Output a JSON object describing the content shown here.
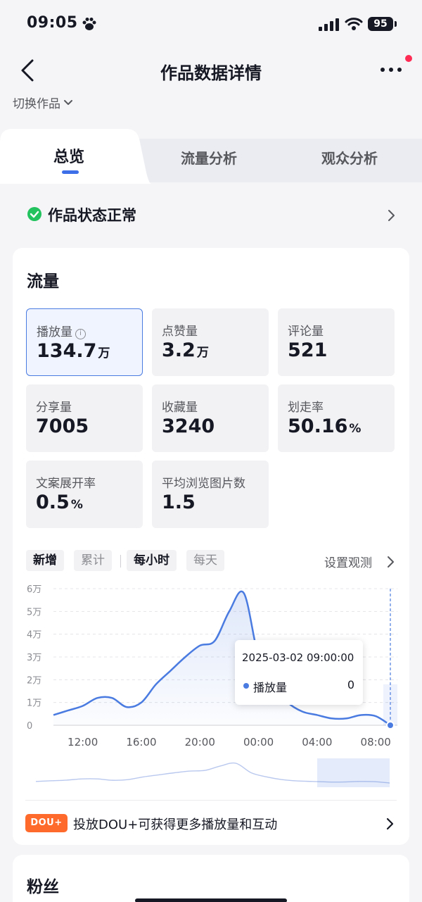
{
  "status_bar": {
    "time": "09:05",
    "battery": "95"
  },
  "nav": {
    "title": "作品数据详情"
  },
  "switch_work": "切换作品",
  "tabs": [
    {
      "label": "总览",
      "active": true
    },
    {
      "label": "流量分析",
      "active": false
    },
    {
      "label": "观众分析",
      "active": false
    }
  ],
  "work_status": "作品状态正常",
  "traffic_card": {
    "title": "流量",
    "metrics": [
      {
        "label": "播放量",
        "value": "134.7",
        "unit": "万",
        "selected": true
      },
      {
        "label": "点赞量",
        "value": "3.2",
        "unit": "万"
      },
      {
        "label": "评论量",
        "value": "521",
        "unit": ""
      },
      {
        "label": "分享量",
        "value": "7005",
        "unit": ""
      },
      {
        "label": "收藏量",
        "value": "3240",
        "unit": ""
      },
      {
        "label": "划走率",
        "value": "50.16",
        "unit": "%"
      },
      {
        "label": "文案展开率",
        "value": "0.5",
        "unit": "%"
      },
      {
        "label": "平均浏览图片数",
        "value": "1.5",
        "unit": ""
      }
    ],
    "chips": {
      "new": "新增",
      "cumulative": "累计",
      "hourly": "每小时",
      "daily": "每天"
    },
    "settings_link": "设置观测",
    "tooltip": {
      "date": "2025-03-02 09:00:00",
      "series": "播放量",
      "value": "0"
    },
    "promo_badge": "DOU+",
    "promo_text": "投放DOU+可获得更多播放量和互动"
  },
  "fans_card": {
    "title": "粉丝"
  },
  "colors": {
    "accent": "#4a7be0",
    "promo": "#fe6a2c",
    "notify": "#fe2c55",
    "ok": "#22c35e"
  },
  "chart_data": {
    "type": "area",
    "series": [
      {
        "name": "播放量",
        "x": [
          "10:00",
          "11:00",
          "12:00",
          "13:00",
          "14:00",
          "15:00",
          "16:00",
          "17:00",
          "18:00",
          "19:00",
          "20:00",
          "21:00",
          "22:00",
          "23:00",
          "00:00",
          "01:00",
          "02:00",
          "03:00",
          "04:00",
          "05:00",
          "06:00",
          "07:00",
          "08:00",
          "09:00"
        ],
        "values": [
          4500,
          6500,
          8500,
          12000,
          12000,
          8000,
          10000,
          18000,
          24000,
          30000,
          35000,
          37000,
          50000,
          58000,
          30000,
          18000,
          10000,
          6000,
          4500,
          3000,
          3000,
          4500,
          4000,
          0
        ]
      }
    ],
    "x_ticks": [
      "12:00",
      "16:00",
      "20:00",
      "00:00",
      "04:00",
      "08:00"
    ],
    "y_ticks": [
      "0",
      "1万",
      "2万",
      "3万",
      "4万",
      "5万",
      "6万"
    ],
    "ylim": [
      0,
      60000
    ],
    "grid": true,
    "highlighted_point": {
      "x": "09:00",
      "y": 0
    }
  }
}
